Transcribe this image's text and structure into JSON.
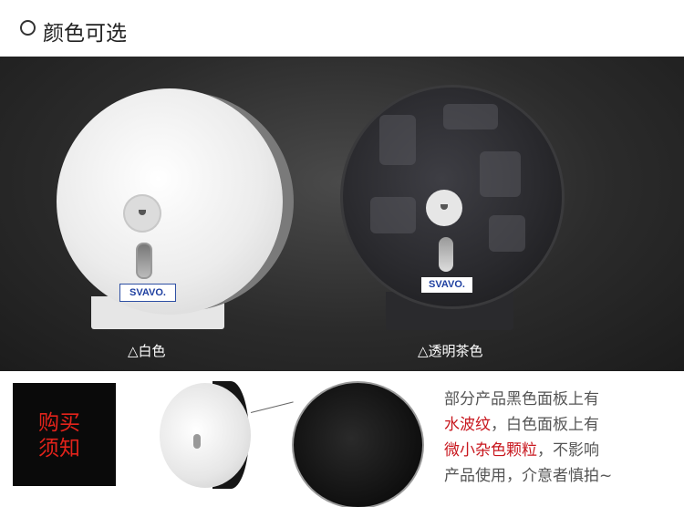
{
  "header": {
    "title": "颜色可选"
  },
  "products": [
    {
      "label": "△白色",
      "brand": "SVAVO."
    },
    {
      "label": "△透明茶色",
      "brand": "SVAVO."
    }
  ],
  "notice": {
    "badge_line1": "购买",
    "badge_line2": "须知",
    "line1": "部分产品黑色面板上有",
    "line2_red": "水波纹",
    "line2_rest": "，白色面板上有",
    "line3_red": "微小杂色颗粒",
    "line3_rest": "，不影响",
    "line4": "产品使用，介意者慎拍~"
  },
  "colors": {
    "accent_red": "#c8171e",
    "stage_bg": "#2b2b2b"
  }
}
